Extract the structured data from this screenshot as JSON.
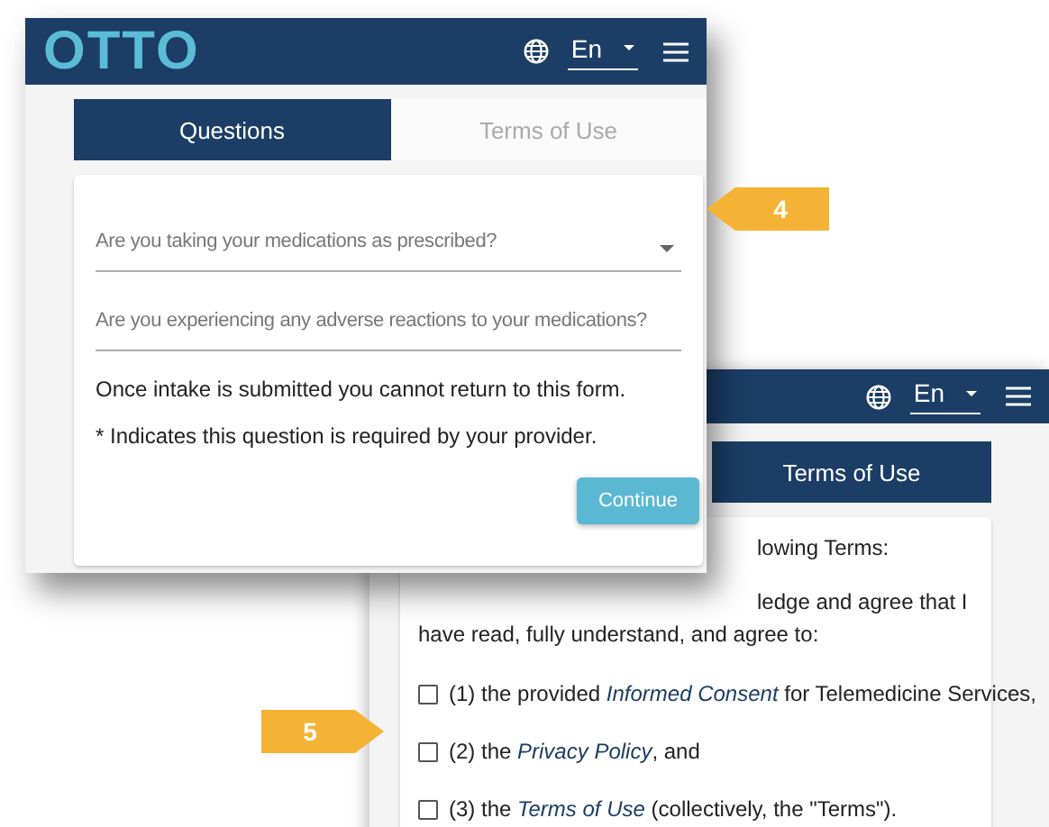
{
  "front_window": {
    "logo": "OTTO",
    "language": "En",
    "tabs": [
      {
        "label": "Questions",
        "selected": true
      },
      {
        "label": "Terms of Use",
        "selected": false
      }
    ],
    "fields": [
      {
        "kind": "select",
        "placeholder": "Are you taking your medications as prescribed?"
      },
      {
        "kind": "text",
        "placeholder": "Are you experiencing any adverse reactions to your medications?"
      }
    ],
    "notes": [
      "Once intake is submitted you cannot return to this form.",
      "* Indicates this question is required by your provider."
    ],
    "button": "Continue"
  },
  "back_window": {
    "language": "En",
    "tabs": [
      {
        "label": "Terms of Use",
        "selected": true
      }
    ],
    "partial_lines": [
      "lowing Terms:",
      "ledge and agree that I"
    ],
    "intro": "have read, fully understand, and agree to:",
    "items": [
      {
        "before": "(1) the provided",
        "link": "Informed Consent",
        "after": "for Telemedicine Services,",
        "checked": false
      },
      {
        "before": "(2) the",
        "link": "Privacy Policy",
        "after": ", and",
        "checked": false
      },
      {
        "before": "(3) the",
        "link": "Terms of Use",
        "after": "(collectively, the \"Terms\").",
        "checked": false
      }
    ]
  },
  "callouts": [
    {
      "label": "4",
      "kind": "left"
    },
    {
      "label": "5",
      "kind": "right"
    }
  ]
}
